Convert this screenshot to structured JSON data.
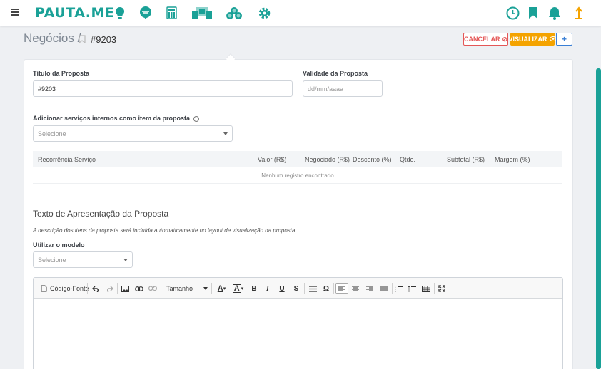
{
  "nav": {
    "logo": "PAUTA.ME",
    "icons": [
      "lightbulb-icon",
      "chat-bubble-icon",
      "calculator-icon",
      "dashboard-icon",
      "coins-icon",
      "gear-icon",
      "clock-icon",
      "bookmark-icon",
      "bell-icon",
      "user-icon"
    ],
    "accent_color": "#1aa197"
  },
  "header": {
    "title": "Negócios /",
    "record_id": "#9203",
    "cancel_label": "CANCELAR",
    "view_label": "VISUALIZAR",
    "add_label": "+"
  },
  "form": {
    "proposal_title_label": "Título da Proposta",
    "proposal_title_value": "#9203",
    "validity_label": "Validade da Proposta",
    "validity_placeholder": "dd/mm/aaaa",
    "internal_services_label": "Adicionar serviços internos como item da proposta",
    "internal_services_select": "Selecione"
  },
  "table": {
    "columns": [
      "Recorrência",
      "Serviço",
      "Valor (R$)",
      "Negociado (R$)",
      "Desconto (%)",
      "Qtde.",
      "Subtotal (R$)",
      "Margem (%)"
    ],
    "empty_message": "Nenhum registro encontrado"
  },
  "presentation": {
    "section_title": "Texto de Apresentação da Proposta",
    "note": "A descrição dos itens da proposta será incluída automaticamente no layout de visualização da proposta.",
    "model_label": "Utilizar o modelo",
    "model_select": "Selecione"
  },
  "editor": {
    "source_label": "Código-Fonte",
    "size_label": "Tamanho",
    "bold": "B",
    "italic": "I",
    "underline": "U",
    "strike": "S",
    "omega": "Ω"
  },
  "colors": {
    "cancel": "#e45656",
    "view": "#f4a300",
    "add": "#3a7fd5"
  }
}
